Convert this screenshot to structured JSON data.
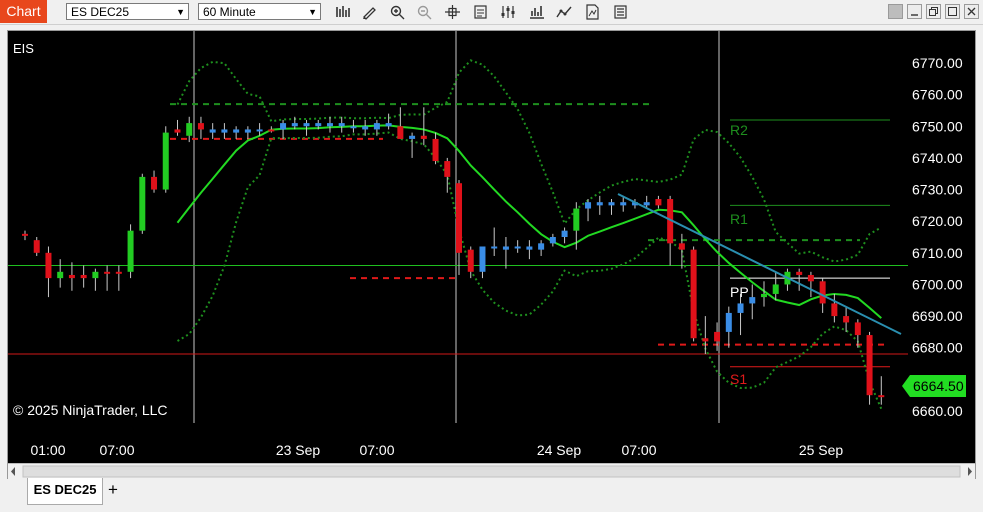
{
  "window": {
    "title_tab": "Chart",
    "instrument_select": "ES DEC25",
    "interval_select": "60 Minute",
    "toolbar_icons": [
      "bar-style-icon",
      "drawing-tool-icon",
      "zoom-in-icon",
      "zoom-out-icon",
      "crosshair-icon",
      "data-box-icon",
      "properties-icon",
      "strategies-icon",
      "indicators-icon",
      "templates-icon",
      "more-icon"
    ],
    "window_buttons": [
      "snap-button",
      "minimize-button",
      "maximize-button",
      "close-button"
    ]
  },
  "chart": {
    "instrument_label": "EIS",
    "copyright": "© 2025 NinjaTrader, LLC",
    "last_price_badge": "6664.50",
    "pivot_labels": {
      "r2": "R2",
      "r1": "R1",
      "pp": "PP",
      "s1": "S1"
    },
    "colors": {
      "background": "#000000",
      "up_candle": "#22cc22",
      "down_candle": "#e0111a",
      "blue_candle": "#3a8de6",
      "sma": "#22d922",
      "bollinger": "#1e8f1e",
      "trendline": "#2a8fb0",
      "resistance": "#1e8f1e",
      "support": "#e01a1a",
      "price_badge": "#22dd22"
    }
  },
  "chart_data": {
    "type": "candlestick",
    "y_ticks": [
      "6770.00",
      "6760.00",
      "6750.00",
      "6740.00",
      "6730.00",
      "6720.00",
      "6710.00",
      "6700.00",
      "6690.00",
      "6680.00",
      "6670.00",
      "6660.00"
    ],
    "ylim": [
      6659,
      6781
    ],
    "x_tick_labels": [
      "01:00",
      "07:00",
      "23 Sep",
      "07:00",
      "24 Sep",
      "07:00",
      "25 Sep"
    ],
    "pivot_levels": {
      "R2": 6752,
      "R1": 6725,
      "PP": 6702,
      "S1": 6674
    },
    "levels": {
      "green_horizontal": 6706,
      "red_horizontal": 6678
    },
    "candles": [
      {
        "o": 6716,
        "h": 6717,
        "l": 6714,
        "c": 6716,
        "color": "red"
      },
      {
        "o": 6714,
        "h": 6715,
        "l": 6709,
        "c": 6710,
        "color": "red"
      },
      {
        "o": 6710,
        "h": 6712,
        "l": 6696,
        "c": 6702,
        "color": "red"
      },
      {
        "o": 6704,
        "h": 6708,
        "l": 6699,
        "c": 6702,
        "color": "green"
      },
      {
        "o": 6702,
        "h": 6707,
        "l": 6698,
        "c": 6703,
        "color": "red"
      },
      {
        "o": 6703,
        "h": 6706,
        "l": 6699,
        "c": 6702,
        "color": "red"
      },
      {
        "o": 6702,
        "h": 6705,
        "l": 6698,
        "c": 6704,
        "color": "green"
      },
      {
        "o": 6704,
        "h": 6706,
        "l": 6698,
        "c": 6704,
        "color": "red"
      },
      {
        "o": 6704,
        "h": 6706,
        "l": 6698,
        "c": 6704,
        "color": "red"
      },
      {
        "o": 6704,
        "h": 6719,
        "l": 6702,
        "c": 6717,
        "color": "green"
      },
      {
        "o": 6717,
        "h": 6735,
        "l": 6716,
        "c": 6734,
        "color": "green"
      },
      {
        "o": 6734,
        "h": 6736,
        "l": 6729,
        "c": 6730,
        "color": "red"
      },
      {
        "o": 6730,
        "h": 6750,
        "l": 6729,
        "c": 6748,
        "color": "green"
      },
      {
        "o": 6748,
        "h": 6752,
        "l": 6747,
        "c": 6749,
        "color": "red"
      },
      {
        "o": 6747,
        "h": 6753,
        "l": 6745,
        "c": 6751,
        "color": "green"
      },
      {
        "o": 6751,
        "h": 6753,
        "l": 6746,
        "c": 6749,
        "color": "red"
      },
      {
        "o": 6749,
        "h": 6751,
        "l": 6746,
        "c": 6748,
        "color": "blue"
      },
      {
        "o": 6748,
        "h": 6751,
        "l": 6746,
        "c": 6749,
        "color": "blue"
      },
      {
        "o": 6749,
        "h": 6750,
        "l": 6746,
        "c": 6748,
        "color": "blue"
      },
      {
        "o": 6748,
        "h": 6750,
        "l": 6746,
        "c": 6749,
        "color": "blue"
      },
      {
        "o": 6749,
        "h": 6751,
        "l": 6747,
        "c": 6749,
        "color": "blue"
      },
      {
        "o": 6749,
        "h": 6750,
        "l": 6748,
        "c": 6749,
        "color": "red"
      },
      {
        "o": 6749,
        "h": 6752,
        "l": 6746,
        "c": 6751,
        "color": "blue"
      },
      {
        "o": 6751,
        "h": 6753,
        "l": 6749,
        "c": 6750,
        "color": "blue"
      },
      {
        "o": 6750,
        "h": 6752,
        "l": 6747,
        "c": 6751,
        "color": "blue"
      },
      {
        "o": 6751,
        "h": 6752,
        "l": 6749,
        "c": 6750,
        "color": "blue"
      },
      {
        "o": 6750,
        "h": 6753,
        "l": 6748,
        "c": 6751,
        "color": "blue"
      },
      {
        "o": 6751,
        "h": 6753,
        "l": 6748,
        "c": 6750,
        "color": "blue"
      },
      {
        "o": 6750,
        "h": 6752,
        "l": 6748,
        "c": 6750,
        "color": "blue"
      },
      {
        "o": 6750,
        "h": 6752,
        "l": 6747,
        "c": 6749,
        "color": "blue"
      },
      {
        "o": 6749,
        "h": 6752,
        "l": 6747,
        "c": 6751,
        "color": "blue"
      },
      {
        "o": 6751,
        "h": 6754,
        "l": 6749,
        "c": 6750,
        "color": "blue"
      },
      {
        "o": 6750,
        "h": 6756,
        "l": 6746,
        "c": 6746,
        "color": "red"
      },
      {
        "o": 6746,
        "h": 6748,
        "l": 6740,
        "c": 6747,
        "color": "blue"
      },
      {
        "o": 6747,
        "h": 6756,
        "l": 6744,
        "c": 6746,
        "color": "red"
      },
      {
        "o": 6746,
        "h": 6748,
        "l": 6738,
        "c": 6739,
        "color": "red"
      },
      {
        "o": 6739,
        "h": 6740,
        "l": 6729,
        "c": 6734,
        "color": "red"
      },
      {
        "o": 6732,
        "h": 6733,
        "l": 6703,
        "c": 6710,
        "color": "red"
      },
      {
        "o": 6711,
        "h": 6712,
        "l": 6702,
        "c": 6704,
        "color": "red"
      },
      {
        "o": 6704,
        "h": 6712,
        "l": 6702,
        "c": 6712,
        "color": "blue"
      },
      {
        "o": 6712,
        "h": 6718,
        "l": 6709,
        "c": 6712,
        "color": "blue"
      },
      {
        "o": 6711,
        "h": 6715,
        "l": 6705,
        "c": 6712,
        "color": "blue"
      },
      {
        "o": 6712,
        "h": 6714,
        "l": 6710,
        "c": 6712,
        "color": "blue"
      },
      {
        "o": 6712,
        "h": 6714,
        "l": 6708,
        "c": 6711,
        "color": "blue"
      },
      {
        "o": 6711,
        "h": 6714,
        "l": 6709,
        "c": 6713,
        "color": "blue"
      },
      {
        "o": 6713,
        "h": 6716,
        "l": 6712,
        "c": 6715,
        "color": "blue"
      },
      {
        "o": 6715,
        "h": 6718,
        "l": 6713,
        "c": 6717,
        "color": "blue"
      },
      {
        "o": 6717,
        "h": 6726,
        "l": 6711,
        "c": 6724,
        "color": "green"
      },
      {
        "o": 6724,
        "h": 6727,
        "l": 6720,
        "c": 6726,
        "color": "blue"
      },
      {
        "o": 6726,
        "h": 6728,
        "l": 6722,
        "c": 6725,
        "color": "blue"
      },
      {
        "o": 6725,
        "h": 6727,
        "l": 6722,
        "c": 6726,
        "color": "blue"
      },
      {
        "o": 6726,
        "h": 6728,
        "l": 6723,
        "c": 6725,
        "color": "blue"
      },
      {
        "o": 6725,
        "h": 6727,
        "l": 6724,
        "c": 6726,
        "color": "blue"
      },
      {
        "o": 6726,
        "h": 6728,
        "l": 6724,
        "c": 6725,
        "color": "blue"
      },
      {
        "o": 6725,
        "h": 6728,
        "l": 6724,
        "c": 6727,
        "color": "red"
      },
      {
        "o": 6727,
        "h": 6728,
        "l": 6706,
        "c": 6713,
        "color": "red"
      },
      {
        "o": 6713,
        "h": 6716,
        "l": 6705,
        "c": 6711,
        "color": "red"
      },
      {
        "o": 6711,
        "h": 6712,
        "l": 6682,
        "c": 6683,
        "color": "red"
      },
      {
        "o": 6683,
        "h": 6690,
        "l": 6678,
        "c": 6682,
        "color": "red"
      },
      {
        "o": 6682,
        "h": 6688,
        "l": 6679,
        "c": 6685,
        "color": "red"
      },
      {
        "o": 6685,
        "h": 6693,
        "l": 6680,
        "c": 6691,
        "color": "blue"
      },
      {
        "o": 6691,
        "h": 6697,
        "l": 6684,
        "c": 6694,
        "color": "blue"
      },
      {
        "o": 6694,
        "h": 6700,
        "l": 6689,
        "c": 6696,
        "color": "blue"
      },
      {
        "o": 6696,
        "h": 6701,
        "l": 6693,
        "c": 6697,
        "color": "green"
      },
      {
        "o": 6697,
        "h": 6704,
        "l": 6695,
        "c": 6700,
        "color": "green"
      },
      {
        "o": 6700,
        "h": 6705,
        "l": 6698,
        "c": 6704,
        "color": "green"
      },
      {
        "o": 6704,
        "h": 6705,
        "l": 6698,
        "c": 6703,
        "color": "red"
      },
      {
        "o": 6703,
        "h": 6704,
        "l": 6696,
        "c": 6701,
        "color": "red"
      },
      {
        "o": 6701,
        "h": 6702,
        "l": 6691,
        "c": 6694,
        "color": "red"
      },
      {
        "o": 6694,
        "h": 6697,
        "l": 6688,
        "c": 6690,
        "color": "red"
      },
      {
        "o": 6690,
        "h": 6693,
        "l": 6685,
        "c": 6688,
        "color": "red"
      },
      {
        "o": 6688,
        "h": 6689,
        "l": 6680,
        "c": 6684,
        "color": "red"
      },
      {
        "o": 6684,
        "h": 6685,
        "l": 6662,
        "c": 6665,
        "color": "red"
      },
      {
        "o": 6665,
        "h": 6671,
        "l": 6662,
        "c": 6664.5,
        "color": "red"
      }
    ]
  }
}
